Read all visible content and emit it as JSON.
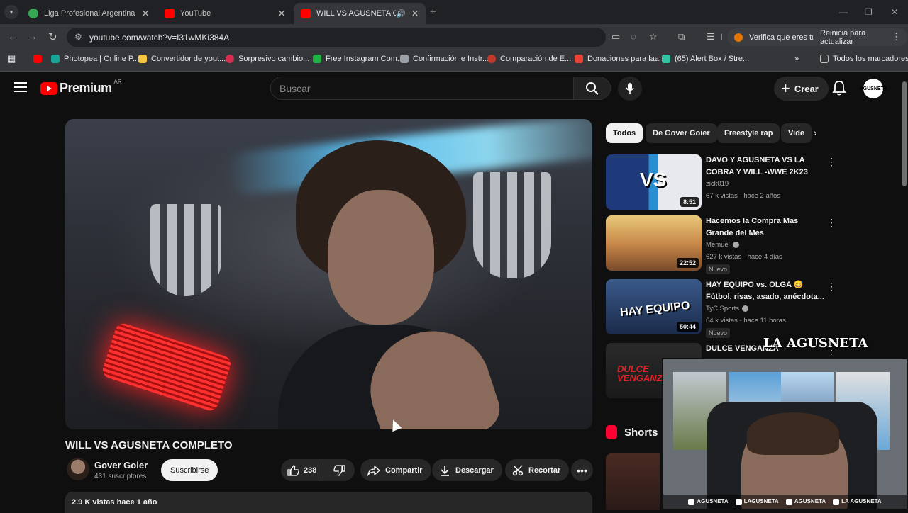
{
  "browser": {
    "tabs": [
      {
        "title": "Liga Profesional Argentina - P.C",
        "favicon_color": "#34a853",
        "active": false
      },
      {
        "title": "YouTube",
        "favicon_color": "#ff0000",
        "active": false
      },
      {
        "title": "WILL VS AGUSNETA COMPL",
        "favicon_color": "#ff0000",
        "active": true
      }
    ],
    "url": "youtube.com/watch?v=I31wMKi384A",
    "verify_label": "Verifica que eres tú",
    "update_label": "Reinicia para actualizar",
    "bookmarks": [
      {
        "label": "",
        "color": "#ff0000"
      },
      {
        "label": "Photopea | Online P...",
        "color": "#18a497"
      },
      {
        "label": "Convertidor de yout...",
        "color": "#f4c542"
      },
      {
        "label": "Sorpresivo cambio...",
        "color": "#d62e4f"
      },
      {
        "label": "Free Instagram Com...",
        "color": "#1fb141"
      },
      {
        "label": "Confirmación e Instr...",
        "color": "#9aa0a6"
      },
      {
        "label": "Comparación de E...",
        "color": "#c0392b"
      },
      {
        "label": "Donaciones para laa...",
        "color": "#ea4335"
      },
      {
        "label": "(65) Alert Box / Stre...",
        "color": "#31c3a2"
      }
    ],
    "all_bookmarks": "Todos los marcadores"
  },
  "header": {
    "logo_text": "Premium",
    "region": "AR",
    "search_placeholder": "Buscar",
    "create_label": "Crear",
    "avatar_text": "AGUSNETA"
  },
  "video": {
    "title": "WILL VS AGUSNETA COMPLETO",
    "channel": "Gover Goier",
    "subscribers": "431 suscriptores",
    "subscribe_label": "Suscribirse",
    "likes": "238",
    "share_label": "Compartir",
    "download_label": "Descargar",
    "clip_label": "Recortar",
    "views_date": "2.9 K vistas  hace 1 año"
  },
  "chips": [
    "Todos",
    "De Gover Goier",
    "Freestyle rap",
    "Vide"
  ],
  "recommendations": [
    {
      "title": "DAVO Y AGUSNETA VS LA COBRA Y WILL -WWE 2K23",
      "channel": "zick019",
      "verified": false,
      "meta": "67 k vistas · hace 2 años",
      "duration": "8:51",
      "badge": "",
      "thumb_text": "VS"
    },
    {
      "title": "Hacemos la Compra Mas Grande del Mes",
      "channel": "Memuel",
      "verified": true,
      "meta": "627 k vistas · hace 4 días",
      "duration": "22:52",
      "badge": "Nuevo",
      "thumb_text": ""
    },
    {
      "title": "HAY EQUIPO vs. OLGA 😅 Fútbol, risas, asado, anécdota...",
      "channel": "TyC Sports",
      "verified": true,
      "meta": "64 k vistas · hace 11 horas",
      "duration": "50:44",
      "badge": "Nuevo",
      "thumb_text": "HAY EQUIPO"
    },
    {
      "title": "DULCE VENGANZA",
      "channel": "",
      "verified": false,
      "meta": "",
      "duration": "",
      "badge": "",
      "thumb_text": "DULCE VENGANZA"
    }
  ],
  "shorts_label": "Shorts",
  "overlay": {
    "watermark": "LA AGUSNETA",
    "socials": [
      "AGUSNETA",
      "LAGUSNETA",
      "AGUSNETA",
      "LA AGUSNETA"
    ]
  }
}
